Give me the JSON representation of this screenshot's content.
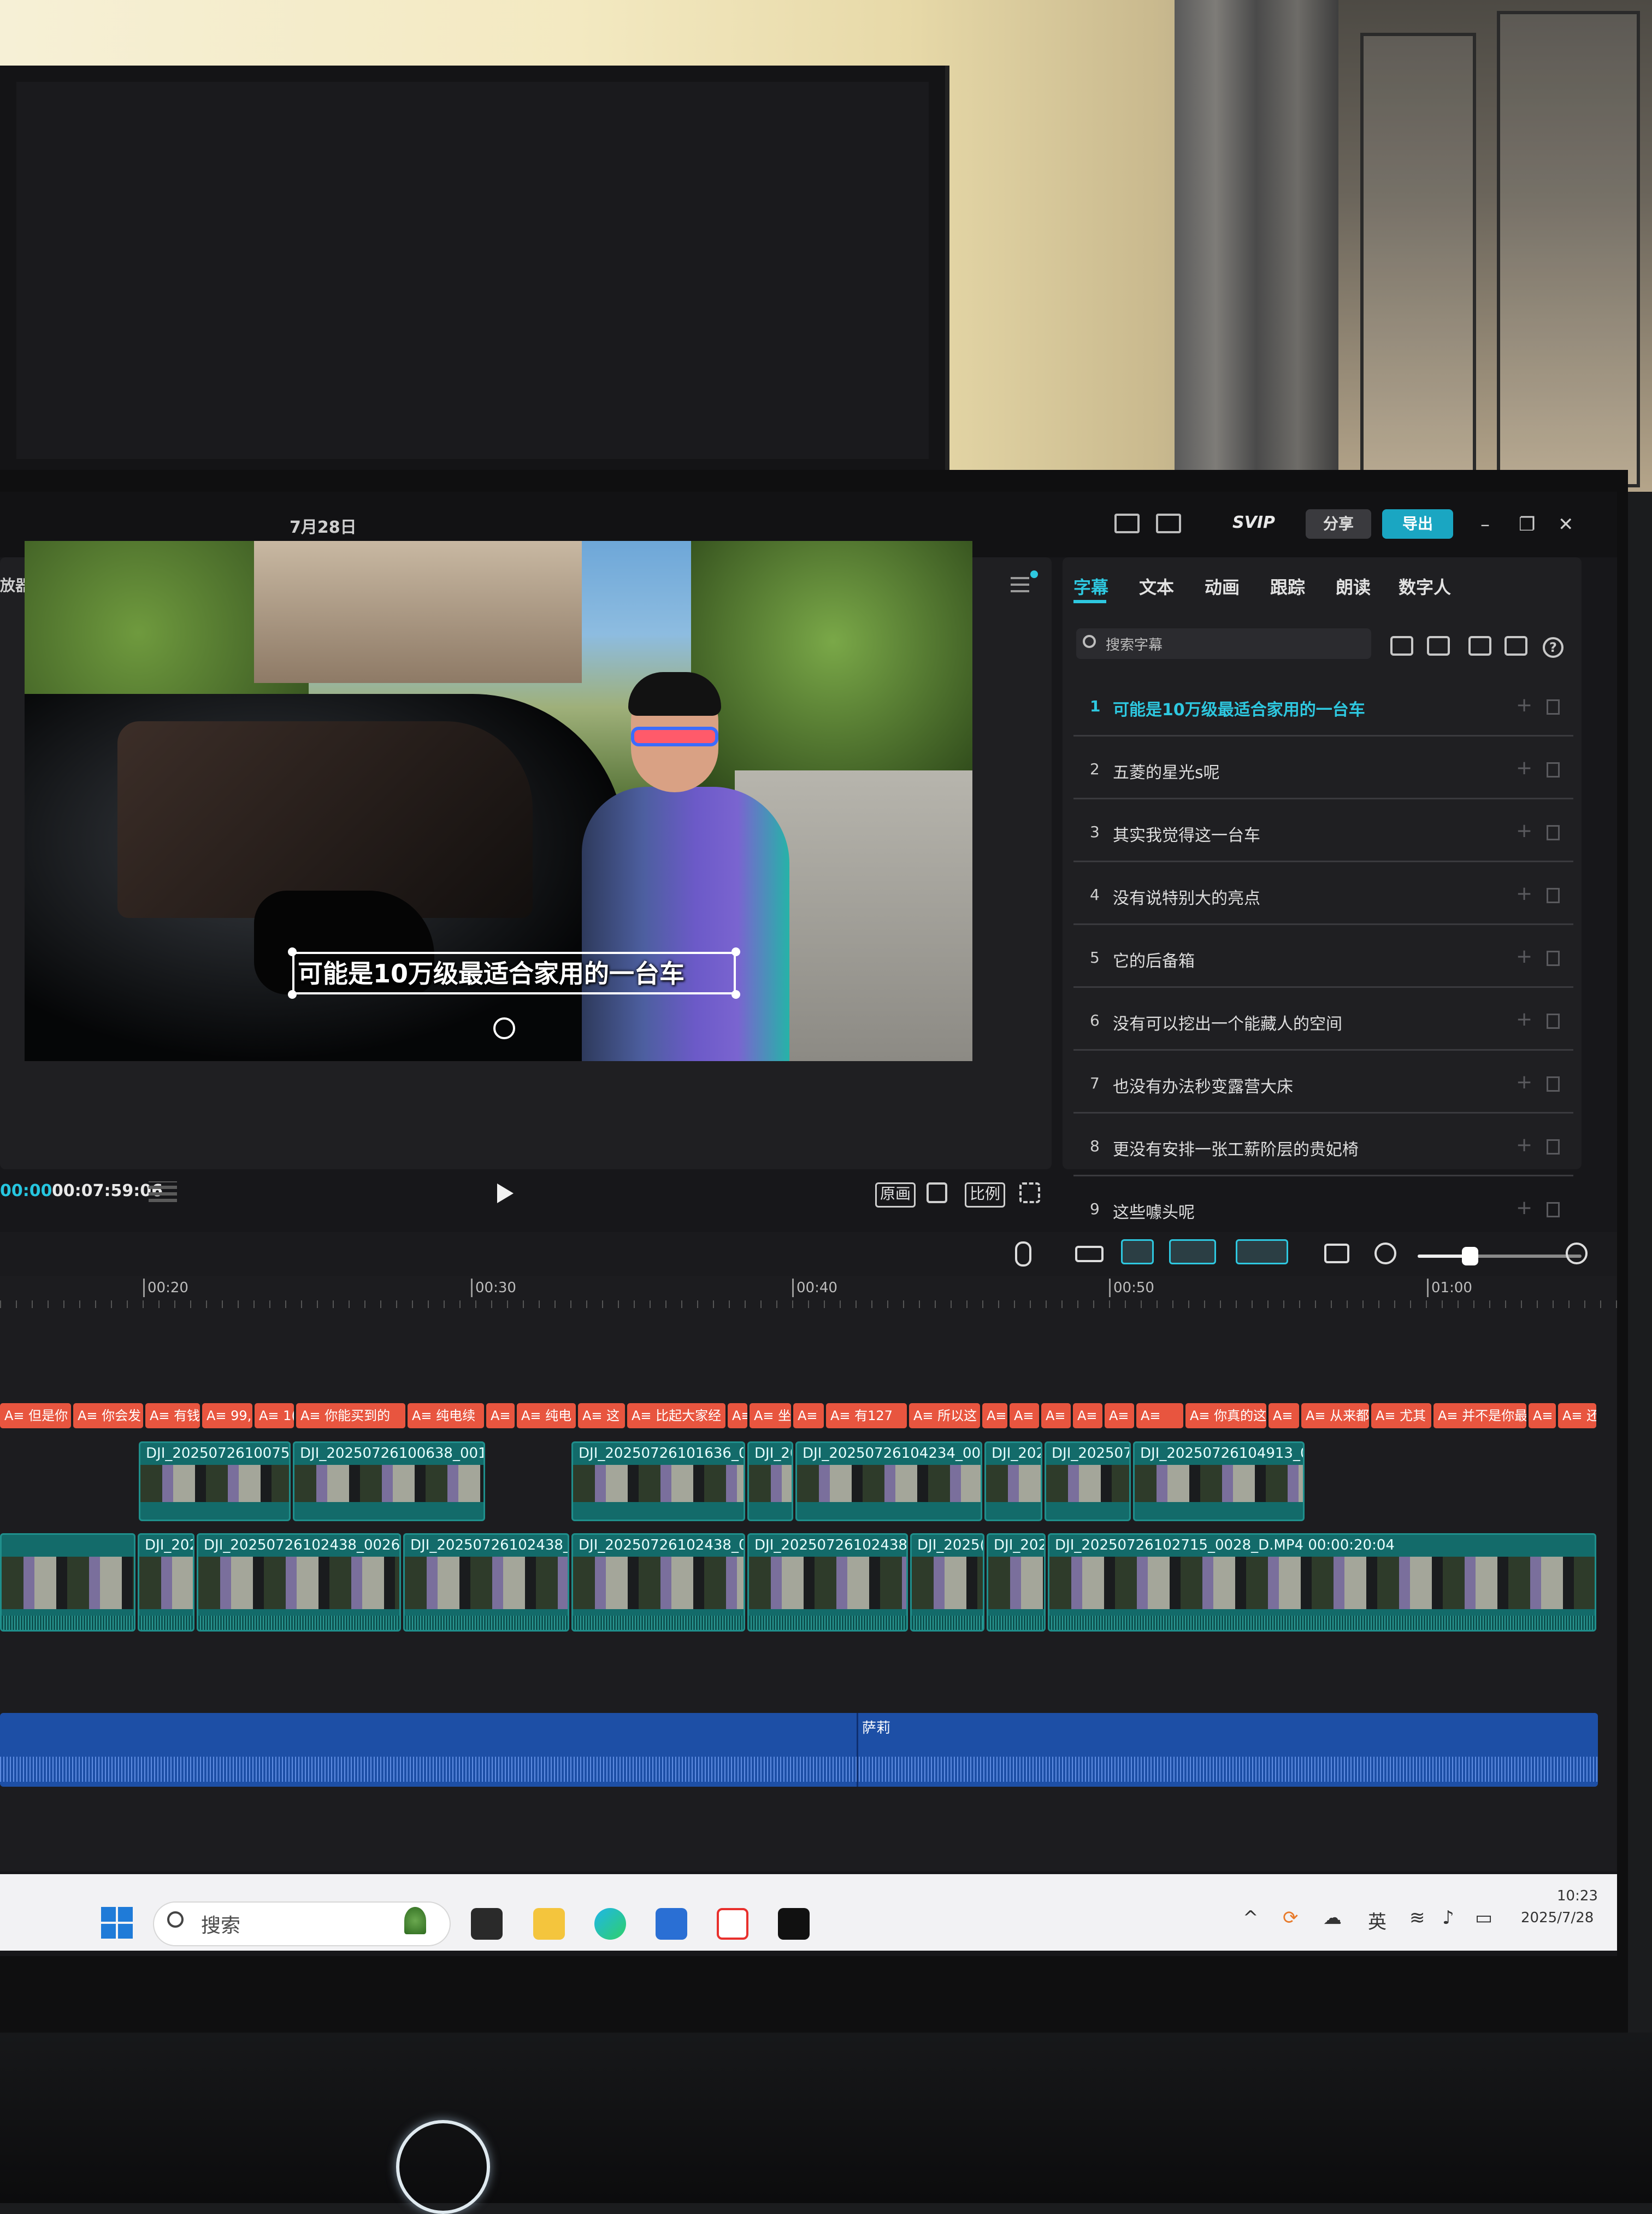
{
  "titlebar": {
    "date": "7月28日",
    "svip": "SVIP",
    "share": "分享",
    "export": "导出"
  },
  "player": {
    "title": "放器",
    "subtitle_overlay": "可能是10万级最适合家用的一台车",
    "time_current": "00:00",
    "time_total": "00:07:59:06",
    "btn_original": "原画",
    "btn_ratio": "比例"
  },
  "right_panel": {
    "tabs": [
      "字幕",
      "文本",
      "动画",
      "跟踪",
      "朗读",
      "数字人"
    ],
    "search_placeholder": "搜索字幕",
    "subtitles": [
      {
        "num": "1",
        "text": "可能是10万级最适合家用的一台车"
      },
      {
        "num": "2",
        "text": "五菱的星光s呢"
      },
      {
        "num": "3",
        "text": "其实我觉得这一台车"
      },
      {
        "num": "4",
        "text": "没有说特别大的亮点"
      },
      {
        "num": "5",
        "text": "它的后备箱"
      },
      {
        "num": "6",
        "text": "没有可以挖出一个能藏人的空间"
      },
      {
        "num": "7",
        "text": "也没有办法秒变露营大床"
      },
      {
        "num": "8",
        "text": "更没有安排一张工薪阶层的贵妃椅"
      },
      {
        "num": "9",
        "text": "这些噱头呢"
      }
    ]
  },
  "timeline": {
    "ticks": [
      "00:20",
      "00:30",
      "00:40",
      "00:50",
      "01:00"
    ],
    "caption_chips": [
      "A≡ 但是你",
      "A≡ 你会发",
      "A≡ 有钱",
      "A≡ 99,",
      "A≡ 1(",
      "A≡ 你能买到的",
      "A≡ 纯电续",
      "A≡",
      "A≡ 纯电",
      "A≡ 这",
      "A≡ 比起大家经",
      "A≡",
      "A≡ 坐",
      "A≡",
      "A≡ 有127",
      "A≡ 所以这",
      "A≡",
      "A≡",
      "A≡",
      "A≡",
      "A≡ I",
      "A≡",
      "A≡ 你真的这",
      "A≡",
      "A≡ 从来都",
      "A≡ 尤其",
      "A≡ 并不是你最",
      "A≡",
      "A≡ 还"
    ],
    "clips_top": [
      "DJI_20250726100752_",
      "DJI_20250726100638_0010",
      "DJI_20250726101636_001",
      "DJI_20",
      "DJI_20250726104234_0040",
      "DJI_202",
      "DJI_2025072",
      "DJI_20250726104913_005"
    ],
    "clips_main": [
      "",
      "DJI_202",
      "DJI_20250726102438_0026_D.",
      "DJI_20250726102438_00",
      "DJI_20250726102438_002",
      "DJI_20250726102438_0",
      "DJI_2025(",
      "DJI_2025",
      "DJI_20250726102715_0028_D.MP4   00:00:20:04"
    ],
    "audio_label": "萨莉"
  },
  "taskbar": {
    "search": "搜索",
    "ime": "英",
    "time": "10:23",
    "date": "2025/7/28"
  },
  "colors": {
    "accent": "#2ec8e0",
    "export": "#1aa6c2",
    "caption_chip": "#e8553f",
    "video_clip": "#136b6a",
    "audio_clip": "#1d4fa6"
  }
}
